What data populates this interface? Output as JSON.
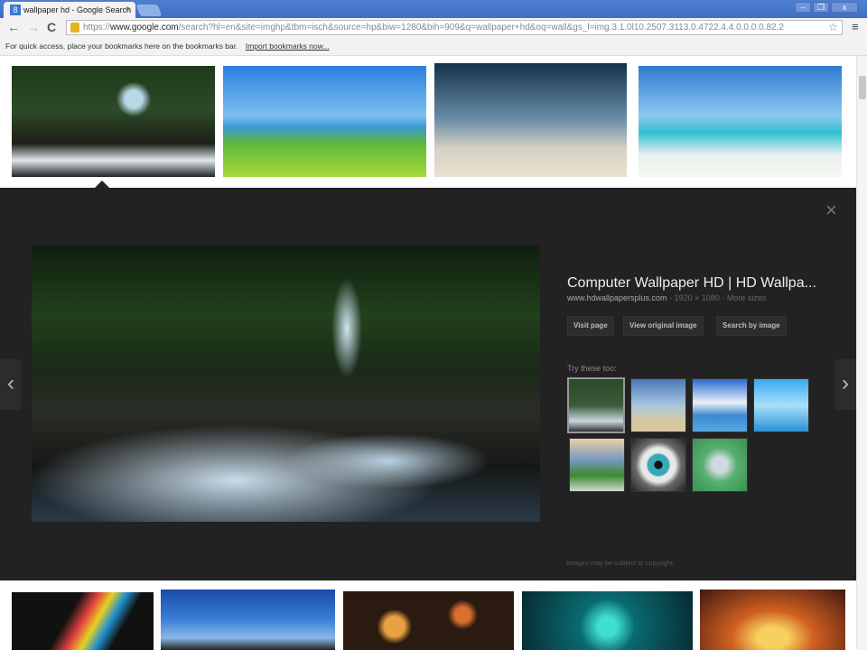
{
  "browser": {
    "tab_title": "wallpaper hd - Google Search",
    "tab_close": "×",
    "favicon": "8",
    "window_controls": [
      "–",
      "❐",
      "x"
    ],
    "nav": {
      "back": "←",
      "forward": "→",
      "reload": "C"
    },
    "url_prefix": "https://",
    "url_host": "www.google.com",
    "url_path": "/search?hl=en&site=imghp&tbm=isch&source=hp&biw=1280&bih=909&q=wallpaper+hd&oq=wall&gs_l=img.3.1.0l10.2507.3113.0.4722.4.4.0.0.0.0.82.2",
    "star": "☆",
    "menu": "≡",
    "bookmarks_text": "For quick access, place your bookmarks here on the bookmarks bar.",
    "import_link": "Import bookmarks now..."
  },
  "viewer": {
    "close": "×",
    "prev": "‹",
    "next": "›",
    "title": "Computer Wallpaper HD | HD Wallpa...",
    "source": "www.hdwallpapersplus.com",
    "dims": " - 1920 × 1080 - More sizes",
    "buttons": [
      "Visit page",
      "View original image",
      "Search by image"
    ],
    "try_label": "Try these too:",
    "copyright": "Images may be subject to copyright."
  },
  "colors": {
    "panel": "#222222",
    "titlebar": "#4f7fd0"
  }
}
